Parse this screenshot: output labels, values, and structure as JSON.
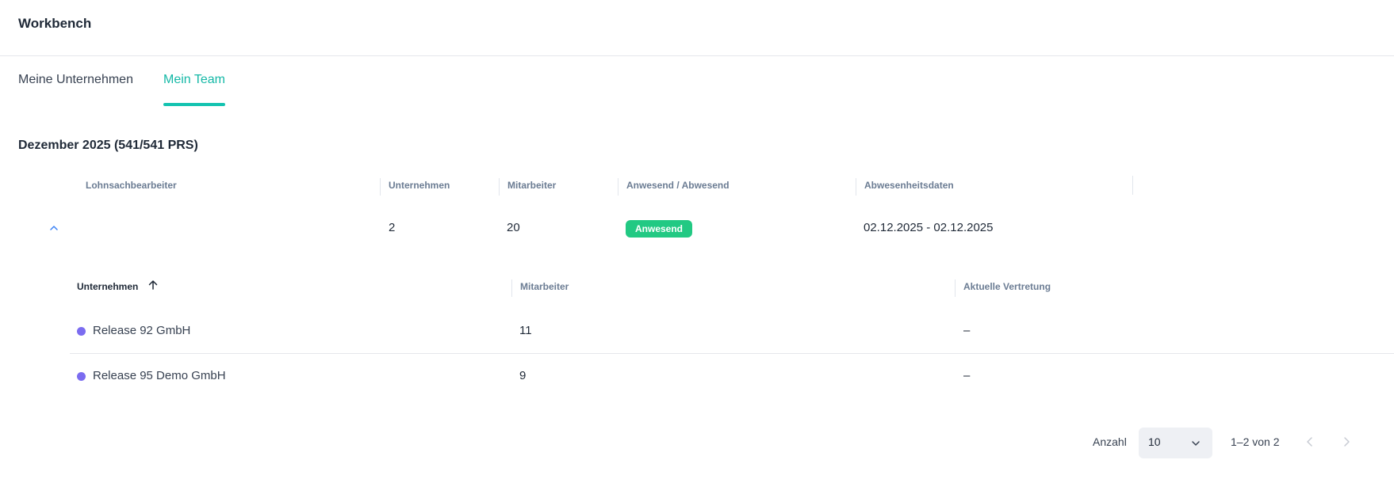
{
  "app": {
    "title": "Workbench"
  },
  "tabs": [
    {
      "label": "Meine Unternehmen",
      "active": false
    },
    {
      "label": "Mein Team",
      "active": true
    }
  ],
  "accent_color": "#14c3b0",
  "section": {
    "title": "Dezember 2025 (541/541 PRS)"
  },
  "table": {
    "columns": [
      "Lohnsachbearbeiter",
      "Unternehmen",
      "Mitarbeiter",
      "Anwesend / Abwesend",
      "Abwesenheitsdaten"
    ],
    "row": {
      "lohnsachbearbeiter": "",
      "unternehmen": "2",
      "mitarbeiter": "20",
      "status": "Anwesend",
      "status_color": "#22c983",
      "abwesenheitsdaten": "02.12.2025 - 02.12.2025",
      "expand_icon": "chevron-up-icon"
    }
  },
  "subtable": {
    "columns": [
      "Unternehmen",
      "Mitarbeiter",
      "Aktuelle Vertretung"
    ],
    "sort_icon": "arrow-up-icon",
    "dot_color": "#7b6cf0",
    "rows": [
      {
        "name": "Release 92 GmbH",
        "mitarbeiter": "11",
        "vertretung": "–"
      },
      {
        "name": "Release 95 Demo GmbH",
        "mitarbeiter": "9",
        "vertretung": "–"
      }
    ]
  },
  "pagination": {
    "label": "Anzahl",
    "page_size": "10",
    "range": "1–2 von 2",
    "prev_icon": "chevron-left-icon",
    "next_icon": "chevron-right-icon"
  }
}
